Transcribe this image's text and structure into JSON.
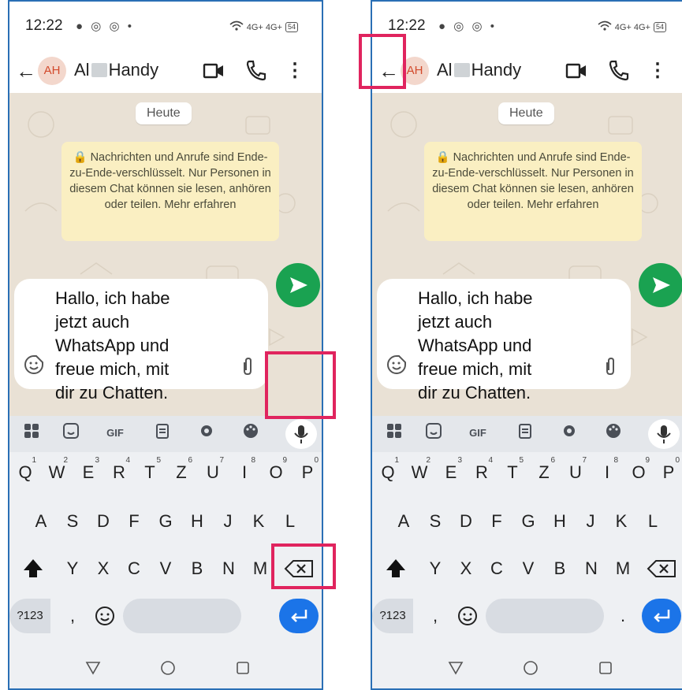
{
  "status": {
    "time": "12:22",
    "left_icons": "● ◎ ◎ •",
    "right_icons": "4G+ 4G+",
    "battery": "54"
  },
  "appbar": {
    "avatar_initials": "AH",
    "contact_first": "Al",
    "contact_last": "Handy"
  },
  "chat": {
    "day_chip": "Heute",
    "encryption_notice": "🔒 Nachrichten und Anrufe sind Ende-zu-Ende-verschlüsselt. Nur Personen in diesem Chat können sie lesen, anhören oder teilen. Mehr erfahren"
  },
  "compose": {
    "text": "Hallo, ich habe\njetzt auch\nWhatsApp und\nfreue mich, mit\ndir zu Chatten."
  },
  "keyboard": {
    "toolbar": {
      "gif": "GIF"
    },
    "row1": [
      {
        "k": "Q",
        "n": "1"
      },
      {
        "k": "W",
        "n": "2"
      },
      {
        "k": "E",
        "n": "3"
      },
      {
        "k": "R",
        "n": "4"
      },
      {
        "k": "T",
        "n": "5"
      },
      {
        "k": "Z",
        "n": "6"
      },
      {
        "k": "U",
        "n": "7"
      },
      {
        "k": "I",
        "n": "8"
      },
      {
        "k": "O",
        "n": "9"
      },
      {
        "k": "P",
        "n": "0"
      }
    ],
    "row2": [
      "A",
      "S",
      "D",
      "F",
      "G",
      "H",
      "J",
      "K",
      "L"
    ],
    "row3": [
      "Y",
      "X",
      "C",
      "V",
      "B",
      "N",
      "M"
    ],
    "symbols_key": "?123",
    "comma": ",",
    "period": "."
  },
  "colors": {
    "highlight": "#e0245e",
    "send_button": "#1aa251",
    "enter_key": "#1b74e8",
    "phone_border": "#2a6fb5"
  },
  "annotations": {
    "left": [
      "send-button",
      "backspace-key"
    ],
    "right": [
      "back-button"
    ]
  }
}
